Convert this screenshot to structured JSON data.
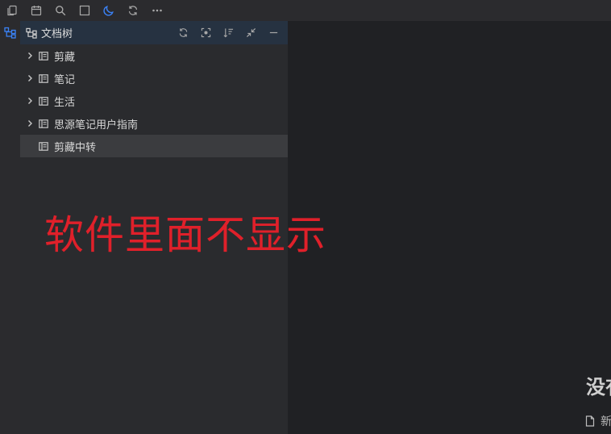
{
  "toolbar": {
    "icons": [
      "copy-icon",
      "calendar-icon",
      "search-icon",
      "square-icon",
      "moon-icon",
      "sync-icon",
      "more-icon"
    ],
    "accent": "#3b82f6"
  },
  "dock": {
    "icon": "file-tree-icon"
  },
  "panel": {
    "title": "文档树",
    "title_icon": "file-tree-icon",
    "actions": [
      "refresh-icon",
      "focus-icon",
      "sort-icon",
      "collapse-icon",
      "minimize-icon"
    ],
    "header_bg": "#263241"
  },
  "tree": {
    "items": [
      {
        "label": "剪藏",
        "expandable": true
      },
      {
        "label": "笔记",
        "expandable": true
      },
      {
        "label": "生活",
        "expandable": true
      },
      {
        "label": "思源笔记用户指南",
        "expandable": true
      },
      {
        "label": "剪藏中转",
        "expandable": false,
        "selected": true
      }
    ]
  },
  "annotation": {
    "text": "软件里面不显示",
    "color": "#e0202a"
  },
  "editor": {
    "empty_title": "没有",
    "new_label": "新建"
  }
}
